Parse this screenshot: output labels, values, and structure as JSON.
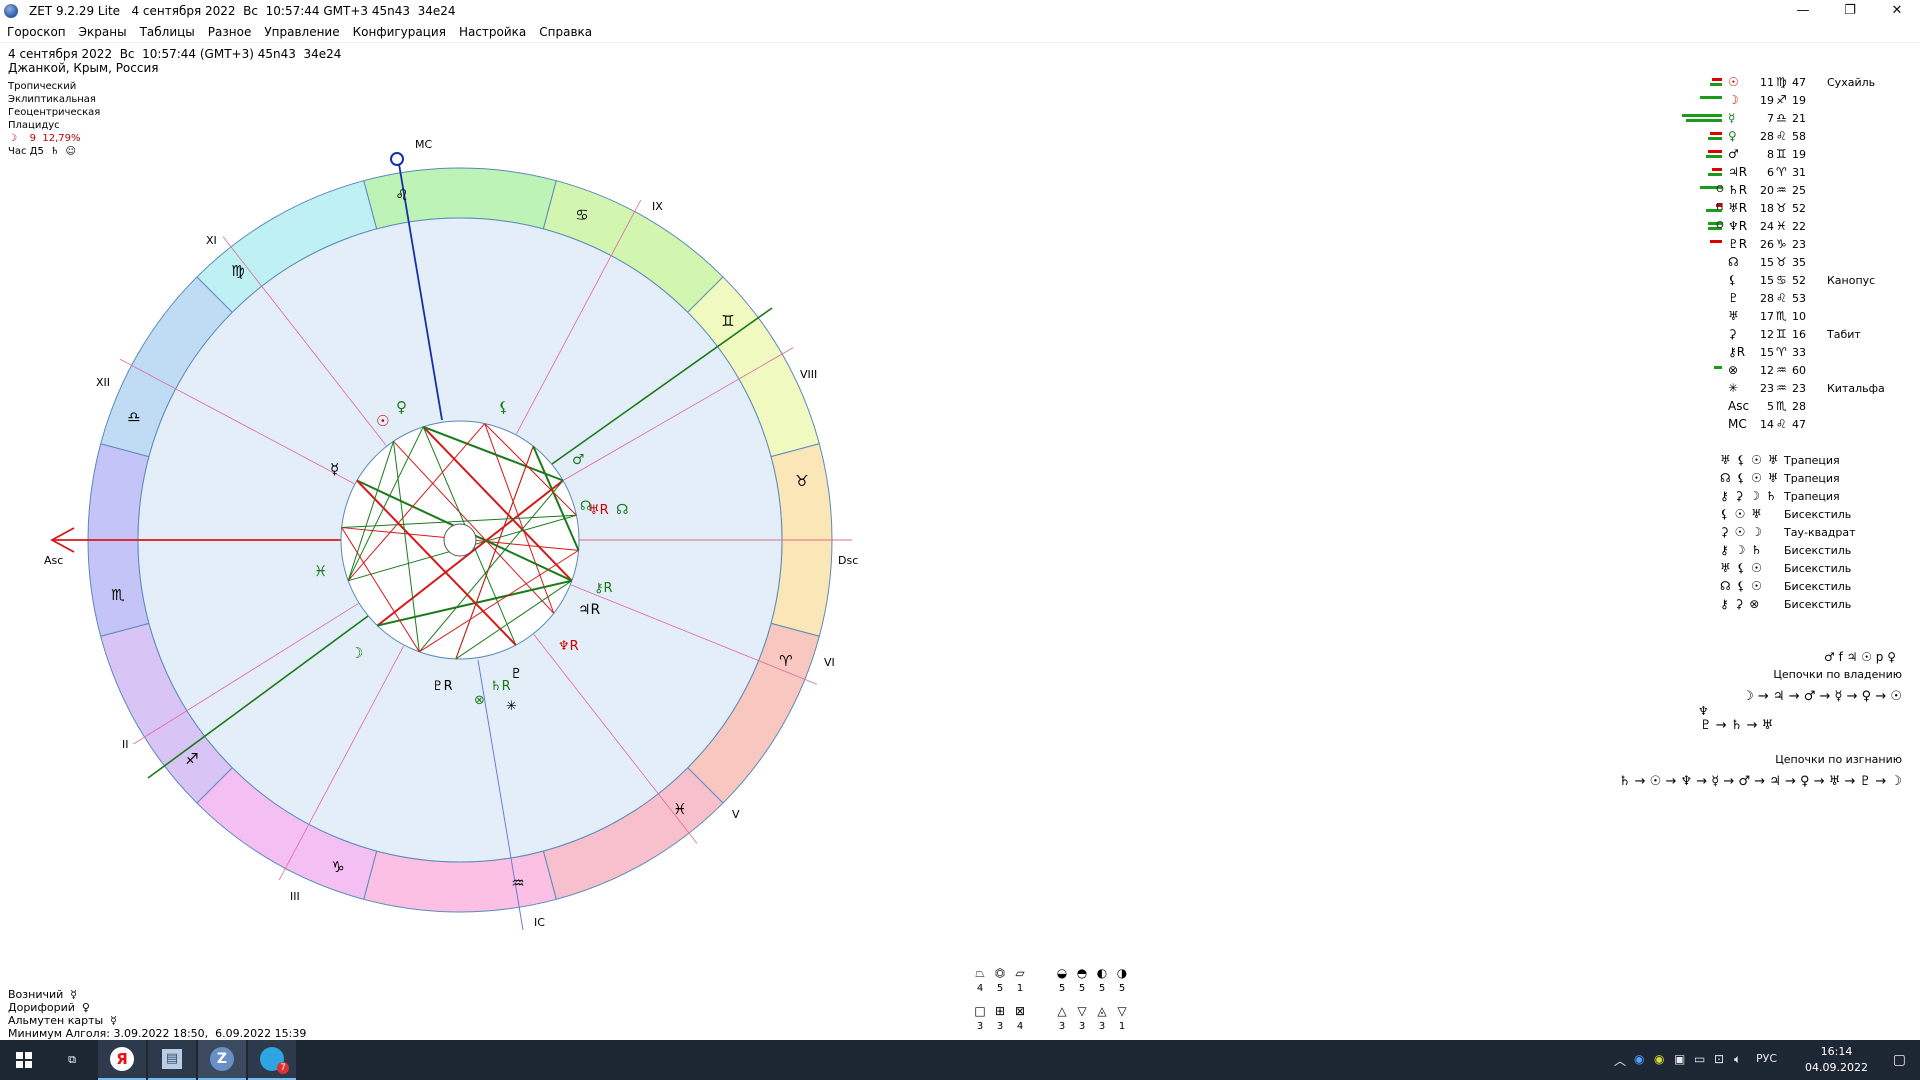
{
  "window": {
    "title": "ZET 9.2.29 Lite   4 сентября 2022  Вс  10:57:44 GMT+3 45n43  34e24",
    "minimize": "—",
    "maximize": "❐",
    "close": "✕"
  },
  "menu": [
    "Гороскоп",
    "Экраны",
    "Таблицы",
    "Разное",
    "Управление",
    "Конфигурация",
    "Настройка",
    "Справка"
  ],
  "chart_info": {
    "line1": "4 сентября 2022  Вс  10:57:44 (GMT+3) 45n43  34e24",
    "line2": "Джанкой, Крым, Россия",
    "system1": "Тропический",
    "system2": "Эклиптикальная",
    "system3": "Геоцентрическая",
    "system4": "Плацидус",
    "moon_phase": "☽    9  12,79%",
    "hour": "Час Д5  ♄  ☺"
  },
  "wheel": {
    "angles": {
      "mc": "MC",
      "ic": "IC",
      "asc": "Asc",
      "dsc": "Dsc"
    },
    "houses": {
      "ix": "IX",
      "viii": "VIII",
      "vi": "VI",
      "v": "V",
      "iii": "III",
      "ii": "II",
      "xii": "XII",
      "xi": "XI"
    },
    "signs": {
      "leo": "♌",
      "cancer": "♋",
      "gemini": "♊",
      "taurus": "♉",
      "aries": "♈",
      "pisces": "♓",
      "aquarius": "♒",
      "capricorn": "♑",
      "sagittarius": "♐",
      "scorpio": "♏",
      "libra": "♎",
      "virgo": "♍"
    },
    "planets": {
      "sun": "☉",
      "venus": "♀",
      "moon_node": "☊",
      "mercury": "☿",
      "black_moon": "⚸",
      "mars": "♂",
      "uranus": "♅R",
      "north_node": "☊",
      "chiron": "⚷R",
      "jupiter": "♃R",
      "neptune": "♆R",
      "pluto": "♇R",
      "saturn": "♄R",
      "proserpina": "♇",
      "fortune": "⊗",
      "vertex": "✳",
      "moon": "☽",
      "pisces_mark": "♓"
    }
  },
  "planet_table": [
    {
      "glyph": "☉",
      "deg": "11",
      "sign": "♍",
      "min": "47",
      "star": "Сухайль",
      "mark": "",
      "color": "#cc0000",
      "bars": [
        {
          "c": "#d00",
          "w": 10
        },
        {
          "c": "#1a9b1a",
          "w": 12
        }
      ]
    },
    {
      "glyph": "☽",
      "deg": "19",
      "sign": "♐",
      "min": "19",
      "star": "",
      "mark": "",
      "color": "#cc0000",
      "bars": [
        {
          "c": "#1a9b1a",
          "w": 22
        }
      ]
    },
    {
      "glyph": "☿",
      "deg": "7",
      "sign": "♎",
      "min": "21",
      "star": "",
      "mark": "",
      "color": "#1a7a1a",
      "bars": [
        {
          "c": "#1a9b1a",
          "w": 40
        },
        {
          "c": "#1a9b1a",
          "w": 36
        }
      ]
    },
    {
      "glyph": "♀",
      "deg": "28",
      "sign": "♌",
      "min": "58",
      "star": "",
      "mark": "",
      "color": "#1a7a1a",
      "bars": [
        {
          "c": "#d00",
          "w": 12
        },
        {
          "c": "#1a9b1a",
          "w": 14
        }
      ]
    },
    {
      "glyph": "♂",
      "deg": "8",
      "sign": "♊",
      "min": "19",
      "star": "",
      "mark": "",
      "color": "#000",
      "bars": [
        {
          "c": "#d00",
          "w": 14
        },
        {
          "c": "#1a9b1a",
          "w": 16
        }
      ]
    },
    {
      "glyph": "♃R",
      "deg": "6",
      "sign": "♈",
      "min": "31",
      "star": "",
      "mark": "",
      "color": "#000",
      "bars": [
        {
          "c": "#d00",
          "w": 10
        },
        {
          "c": "#1a9b1a",
          "w": 14
        }
      ]
    },
    {
      "glyph": "♄R",
      "deg": "20",
      "sign": "♒",
      "min": "25",
      "star": "",
      "mark": "O",
      "color": "#000",
      "bars": [
        {
          "c": "#1a9b1a",
          "w": 22
        }
      ]
    },
    {
      "glyph": "♅R",
      "deg": "18",
      "sign": "♉",
      "min": "52",
      "star": "",
      "mark": "П",
      "color": "#000",
      "bars": [
        {
          "c": "#d00",
          "w": 6
        },
        {
          "c": "#1a9b1a",
          "w": 16
        }
      ]
    },
    {
      "glyph": "♆R",
      "deg": "24",
      "sign": "♓",
      "min": "22",
      "star": "",
      "mark": "O",
      "color": "#000",
      "bars": [
        {
          "c": "#1a9b1a",
          "w": 14
        },
        {
          "c": "#1a9b1a",
          "w": 14
        }
      ]
    },
    {
      "glyph": "♇R",
      "deg": "26",
      "sign": "♑",
      "min": "23",
      "star": "",
      "mark": "",
      "color": "#000",
      "bars": [
        {
          "c": "#d00",
          "w": 12
        }
      ]
    },
    {
      "glyph": "☊",
      "deg": "15",
      "sign": "♉",
      "min": "35",
      "star": "",
      "mark": "",
      "color": "#000",
      "bars": []
    },
    {
      "glyph": "⚸",
      "deg": "15",
      "sign": "♋",
      "min": "52",
      "star": "Канопус",
      "mark": "",
      "color": "#000",
      "bars": []
    },
    {
      "glyph": "♇",
      "deg": "28",
      "sign": "♌",
      "min": "53",
      "star": "",
      "mark": "",
      "color": "#000",
      "bars": []
    },
    {
      "glyph": "♅",
      "deg": "17",
      "sign": "♏",
      "min": "10",
      "star": "",
      "mark": "",
      "color": "#000",
      "bars": []
    },
    {
      "glyph": "⚳",
      "deg": "12",
      "sign": "♊",
      "min": "16",
      "star": "Табит",
      "mark": "",
      "color": "#000",
      "bars": []
    },
    {
      "glyph": "⚷R",
      "deg": "15",
      "sign": "♈",
      "min": "33",
      "star": "",
      "mark": "",
      "color": "#000",
      "bars": []
    },
    {
      "glyph": "⊗",
      "deg": "12",
      "sign": "♒",
      "min": "60",
      "star": "",
      "mark": "",
      "color": "#000",
      "bars": [
        {
          "c": "#1a9b1a",
          "w": 8
        }
      ]
    },
    {
      "glyph": "✳",
      "deg": "23",
      "sign": "♒",
      "min": "23",
      "star": "Китальфа",
      "mark": "",
      "color": "#000",
      "bars": []
    },
    {
      "glyph": "Asc",
      "deg": "5",
      "sign": "♏",
      "min": "28",
      "star": "",
      "mark": "",
      "color": "#000",
      "bars": []
    },
    {
      "glyph": "MC",
      "deg": "14",
      "sign": "♌",
      "min": "47",
      "star": "",
      "mark": "",
      "color": "#000",
      "bars": []
    }
  ],
  "aspect_configs": [
    {
      "glyphs": "♅ ⚸ ☉ ♅",
      "name": "Трапеция"
    },
    {
      "glyphs": "☊ ⚸ ☉ ♅",
      "name": "Трапеция"
    },
    {
      "glyphs": "⚷ ⚳ ☽ ♄",
      "name": "Трапеция"
    },
    {
      "glyphs": "⚸ ☉ ♅",
      "name": "Бисекстиль"
    },
    {
      "glyphs": "⚳ ☉ ☽",
      "name": "Тау-квадрат"
    },
    {
      "glyphs": "⚷ ☽ ♄",
      "name": "Бисекстиль"
    },
    {
      "glyphs": "♅ ⚸ ☉",
      "name": "Бисекстиль"
    },
    {
      "glyphs": "☊ ⚸ ☉",
      "name": "Бисекстиль"
    },
    {
      "glyphs": "⚷ ⚳ ⊗",
      "name": "Бисекстиль"
    }
  ],
  "chains": {
    "header_glyphs": "♂ f ♃  ☉ p ♀",
    "ownership_title": "Цепочки по владению",
    "ownership_chain": "☽ → ♃ → ♂ → ☿ → ♀ → ☉",
    "ownership_sub1": "♆",
    "ownership_sub2": "♇ → ♄ → ♅",
    "exile_title": "Цепочки по изгнанию",
    "exile_chain": "♄ → ☉ → ♆ → ☿ → ♂ → ♃ → ♀ → ♅ → ♇ → ☽"
  },
  "bottom_info": {
    "line1": "Возничий  ☿",
    "line2": "Дорифорий  ♀",
    "line3": "Альмутен карты  ☿",
    "line4": "Минимум Алголя: 3.09.2022 18:50,  6.09.2022 15:39"
  },
  "stats": {
    "row1_icons": [
      "⏢",
      "⏣",
      "⏥",
      "◒",
      "◓",
      "◐",
      "◑"
    ],
    "row1_values": [
      "4",
      "5",
      "1",
      "5",
      "5",
      "5",
      "5"
    ],
    "row2_icons": [
      "□",
      "⊞",
      "⊠",
      "△",
      "▽",
      "◬",
      "▽"
    ],
    "row2_values": [
      "3",
      "3",
      "4",
      "3",
      "3",
      "3",
      "1"
    ]
  },
  "taskbar": {
    "start": "⊞",
    "task_view": "⧉",
    "yandex": "Я",
    "explorer": "▤",
    "zet": "Z",
    "telegram_badge": "7",
    "lang": "РУС",
    "time": "16:14",
    "date": "04.09.2022"
  }
}
